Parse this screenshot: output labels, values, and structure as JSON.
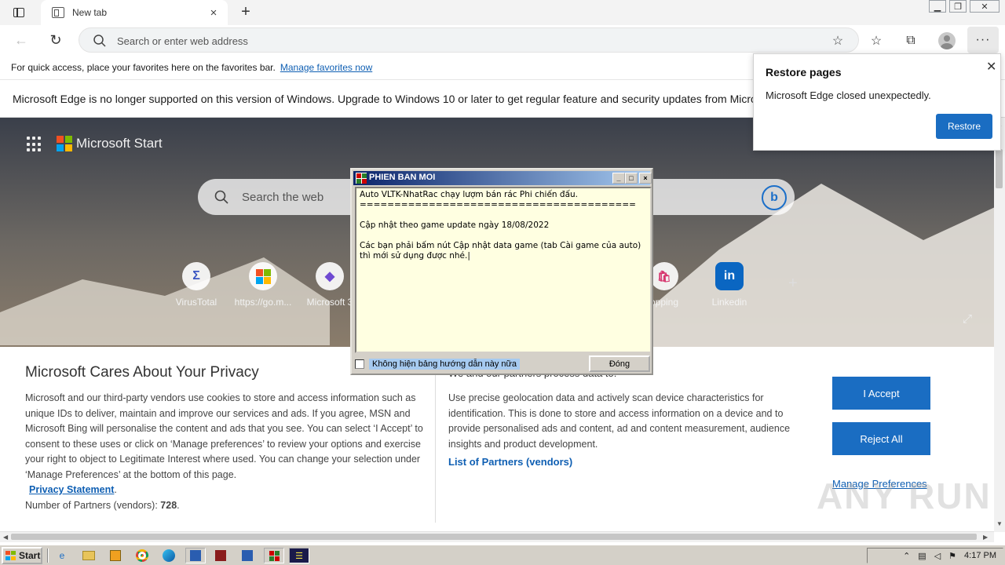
{
  "browser": {
    "tab": {
      "title": "New tab",
      "close": "×"
    },
    "newtab": "+",
    "window_controls": {
      "minimize": "▁",
      "maximize": "❐",
      "close": "✕"
    },
    "address": {
      "placeholder": "Search or enter web address"
    },
    "favorites_bar": {
      "text": "For quick access, place your favorites here on the favorites bar.",
      "link": "Manage favorites now"
    },
    "info_bar": "Microsoft Edge is no longer supported on this version of Windows. Upgrade to Windows 10 or later to get regular feature and security updates from Microsoft Edge."
  },
  "restore_popup": {
    "title": "Restore pages",
    "message": "Microsoft Edge closed unexpectedly.",
    "button": "Restore"
  },
  "start_page": {
    "brand": "Microsoft Start",
    "search_placeholder": "Search the web",
    "bing_icon": "b",
    "quick_links": [
      {
        "label": "VirusTotal",
        "icon": "Σ",
        "color": "#3a55c2"
      },
      {
        "label": "https://go.m...",
        "icon": "",
        "color": "#e74c1c"
      },
      {
        "label": "Microsoft 3",
        "icon": "◆",
        "color": "#6f4ad1"
      },
      {
        "label": "opping",
        "icon": "🛍",
        "color": "#d6336c"
      },
      {
        "label": "Linkedin",
        "icon": "in",
        "color": "#0a66c2"
      }
    ],
    "add_link": "+",
    "expand": "⤢"
  },
  "privacy": {
    "title": "Microsoft Cares About Your Privacy",
    "body": "Microsoft and our third-party vendors use cookies to store and access information such as unique IDs to deliver, maintain and improve our services and ads. If you agree, MSN and Microsoft Bing will personalise the content and ads that you see. You can select ‘I Accept’ to consent to these uses or click on ‘Manage preferences’ to review your options and exercise your right to object to Legitimate Interest where used.  You can change your selection under ‘Manage Preferences’ at the bottom of this page.",
    "privacy_link": "Privacy Statement",
    "privacy_link_suffix": ".",
    "partners_label": "Number of Partners (vendors): ",
    "partners_count": "728",
    "partners_suffix": ".",
    "heading2": "We and our partners process data to:",
    "body2": "Use precise geolocation data and actively scan device characteristics for identification. This is done to store and access information on a device and to provide personalised ads and content, ad and content measurement, audience insights and product development.",
    "partners_link": "List of Partners (vendors)",
    "accept": "I Accept",
    "reject": "Reject All",
    "manage": "Manage Preferences"
  },
  "dialog": {
    "title": "PHIEN BAN MOI",
    "controls": {
      "minimize": "_",
      "maximize": "□",
      "close": "×"
    },
    "text": "Auto VLTK-NhatRac chạy lượm bán rác Phi chiến đấu.\n========================================\n\nCập nhật theo game update ngày 18/08/2022\n\nCác bạn phải bấm nút Cập nhật data game (tab Cài game của auto) thì mới sử dụng được nhé.|",
    "checkbox_label": "Không hiện bảng hướng dẫn này nữa",
    "ok_button": "Đóng"
  },
  "taskbar": {
    "start": "Start",
    "clock": "4:17 PM"
  },
  "watermark": "ANY RUN",
  "colors": {
    "accent": "#1a6dc2",
    "link": "#0f5fb3",
    "dialog_title_start": "#0a246a",
    "dialog_bg": "#ffffe1"
  }
}
